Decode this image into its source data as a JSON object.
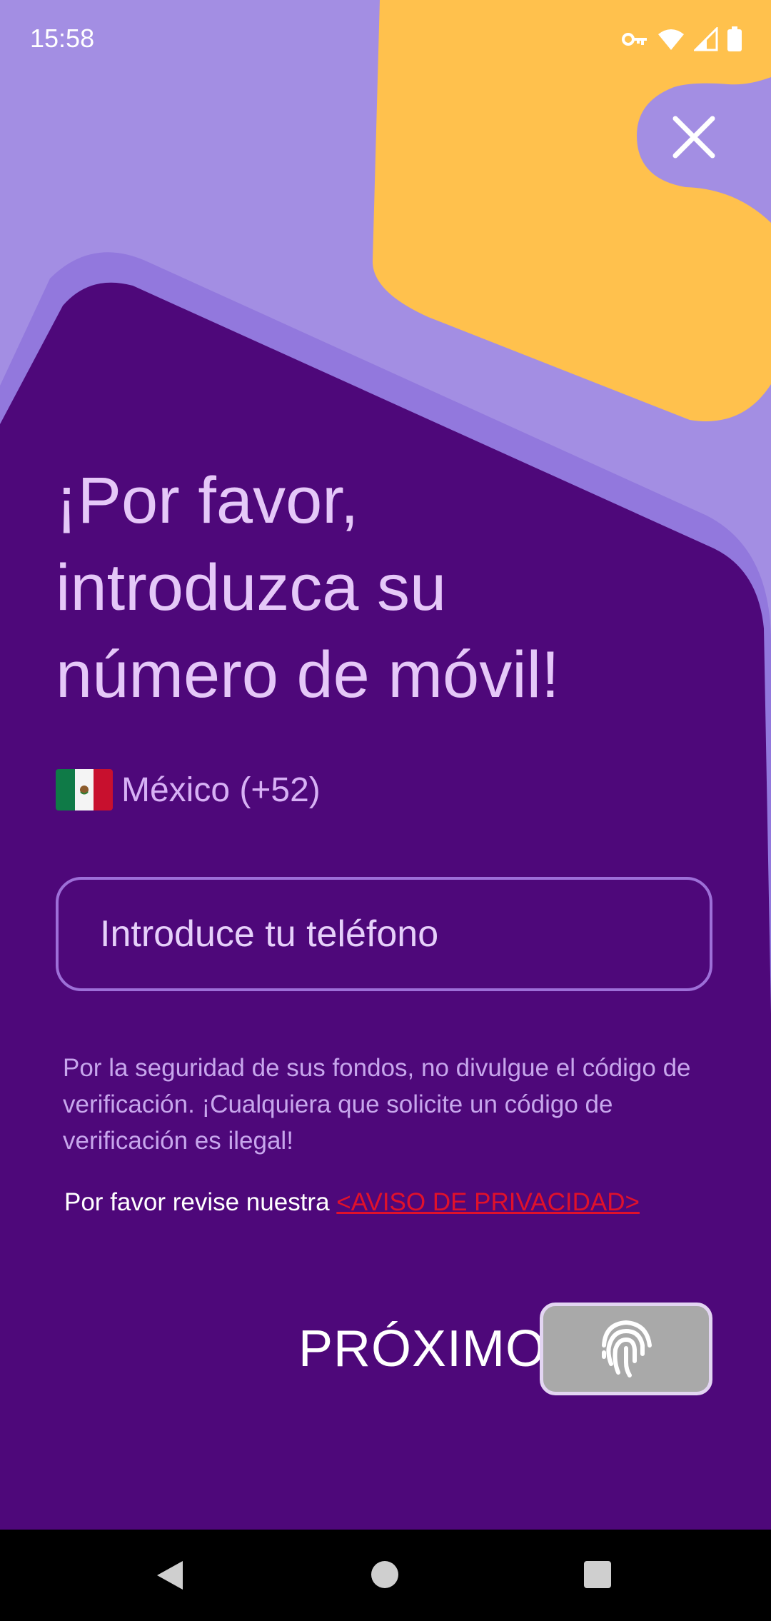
{
  "status_bar": {
    "time": "15:58",
    "icons": [
      "key-icon",
      "wifi-icon",
      "signal-icon",
      "battery-icon"
    ]
  },
  "close_button": {
    "icon": "close-icon"
  },
  "headline": {
    "lines": [
      "¡Por favor,",
      "introduzca su",
      "número de móvil!"
    ]
  },
  "country": {
    "flag": "mexico-flag-icon",
    "label": "México (+52)"
  },
  "phone_input": {
    "placeholder": "Introduce tu teléfono",
    "value": ""
  },
  "security_notice": "Por la seguridad de sus fondos, no divulgue el código de verificación. ¡Cualquiera que solicite un código de verificación es ilegal!",
  "privacy": {
    "prefix": "Por favor revise nuestra ",
    "link": "<AVISO DE PRIVACIDAD>"
  },
  "next": {
    "label": "PRÓXIMO",
    "icon": "fingerprint-icon"
  },
  "navigation": {
    "buttons": [
      "back-icon",
      "home-icon",
      "recents-icon"
    ]
  },
  "colors": {
    "background": "#A38EE3",
    "panel": "#4E087A",
    "accent_yellow": "#FFC14D",
    "headline_text": "#E5C8F8",
    "link_red": "#E0112B"
  }
}
